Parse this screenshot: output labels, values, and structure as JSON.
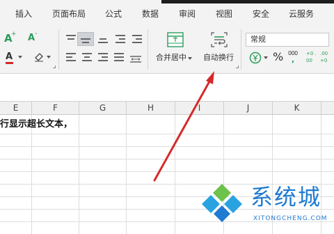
{
  "menu": {
    "tabs": [
      {
        "label": "插入"
      },
      {
        "label": "页面布局"
      },
      {
        "label": "公式"
      },
      {
        "label": "数据"
      },
      {
        "label": "审阅"
      },
      {
        "label": "视图"
      },
      {
        "label": "安全"
      },
      {
        "label": "云服务"
      }
    ]
  },
  "ribbon": {
    "merge_center_label": "合并居中",
    "wrap_text_label": "自动换行",
    "number_format_value": "常规",
    "percent_symbol": "%",
    "thousands_symbol": "000",
    "increase_decimal": "+0 .00",
    "decrease_decimal": ".00 +0",
    "font_color_letter": "A",
    "font_size_up_letter": "A",
    "font_size_down_letter": "A"
  },
  "sheet": {
    "columns": [
      "E",
      "F",
      "G",
      "H",
      "I",
      "J",
      "K"
    ],
    "cell_text": "行显示超长文本，"
  },
  "watermark": {
    "brand": "系统城",
    "url": "XITONGCHENG.COM"
  },
  "colors": {
    "accent_green": "#2a9d5c",
    "arrow_red": "#d42a2a",
    "watermark_blue": "#1f7ad1"
  }
}
